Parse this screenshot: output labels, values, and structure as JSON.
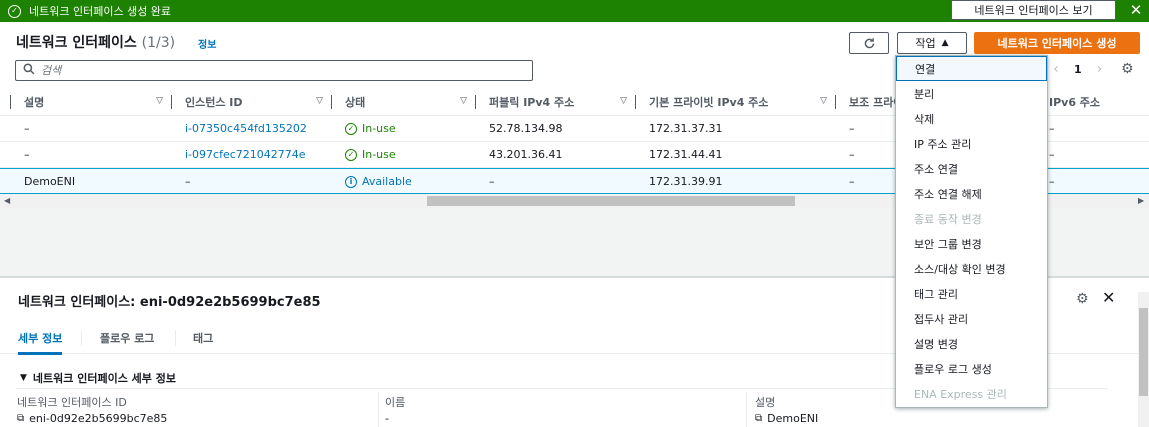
{
  "banner": {
    "message": "네트워크 인터페이스 생성 완료",
    "view_button": "네트워크 인터페이스 보기"
  },
  "header": {
    "title": "네트워크 인터페이스",
    "count": "(1/3)",
    "info_link": "정보",
    "actions_label": "작업",
    "create_label": "네트워크 인터페이스 생성"
  },
  "search": {
    "placeholder": "검색"
  },
  "pagination": {
    "page": "1"
  },
  "table": {
    "columns": [
      "설명",
      "인스턴스 ID",
      "상태",
      "퍼블릭 IPv4 주소",
      "기본 프라이빗 IPv4 주소",
      "보조 프라이",
      "IPv6 주소"
    ],
    "rows": [
      {
        "desc": "–",
        "instance": "i-07350c454fd135202",
        "status": "In-use",
        "public_ip": "52.78.134.98",
        "private_ip": "172.31.37.31",
        "secondary": "–",
        "ipv6": "–"
      },
      {
        "desc": "–",
        "instance": "i-097cfec721042774e",
        "status": "In-use",
        "public_ip": "43.201.36.41",
        "private_ip": "172.31.44.41",
        "secondary": "–",
        "ipv6": "–"
      },
      {
        "desc": "DemoENI",
        "instance": "–",
        "status": "Available",
        "public_ip": "–",
        "private_ip": "172.31.39.91",
        "secondary": "–",
        "ipv6": "–"
      }
    ]
  },
  "details": {
    "title": "네트워크 인터페이스: eni-0d92e2b5699bc7e85",
    "tabs": [
      "세부 정보",
      "플로우 로그",
      "태그"
    ],
    "section_title": "네트워크 인터페이스 세부 정보",
    "fields": [
      {
        "label": "네트워크 인터페이스 ID",
        "value": "eni-0d92e2b5699bc7e85"
      },
      {
        "label": "이름",
        "value": "-"
      },
      {
        "label": "설명",
        "value": "DemoENI"
      }
    ]
  },
  "menu": {
    "items": [
      {
        "label": "연결",
        "state": "highlighted"
      },
      {
        "label": "분리",
        "state": "normal"
      },
      {
        "label": "삭제",
        "state": "normal"
      },
      {
        "label": "IP 주소 관리",
        "state": "normal"
      },
      {
        "label": "주소 연결",
        "state": "normal"
      },
      {
        "label": "주소 연결 해제",
        "state": "normal"
      },
      {
        "label": "종료 동작 변경",
        "state": "disabled"
      },
      {
        "label": "보안 그룹 변경",
        "state": "normal"
      },
      {
        "label": "소스/대상 확인 변경",
        "state": "normal"
      },
      {
        "label": "태그 관리",
        "state": "normal"
      },
      {
        "label": "접두사 관리",
        "state": "normal"
      },
      {
        "label": "설명 변경",
        "state": "normal"
      },
      {
        "label": "플로우 로그 생성",
        "state": "normal"
      },
      {
        "label": "ENA Express 관리",
        "state": "disabled"
      }
    ]
  },
  "colors": {
    "success": "#1d8102",
    "primary": "#ec7211",
    "link": "#0073bb"
  }
}
